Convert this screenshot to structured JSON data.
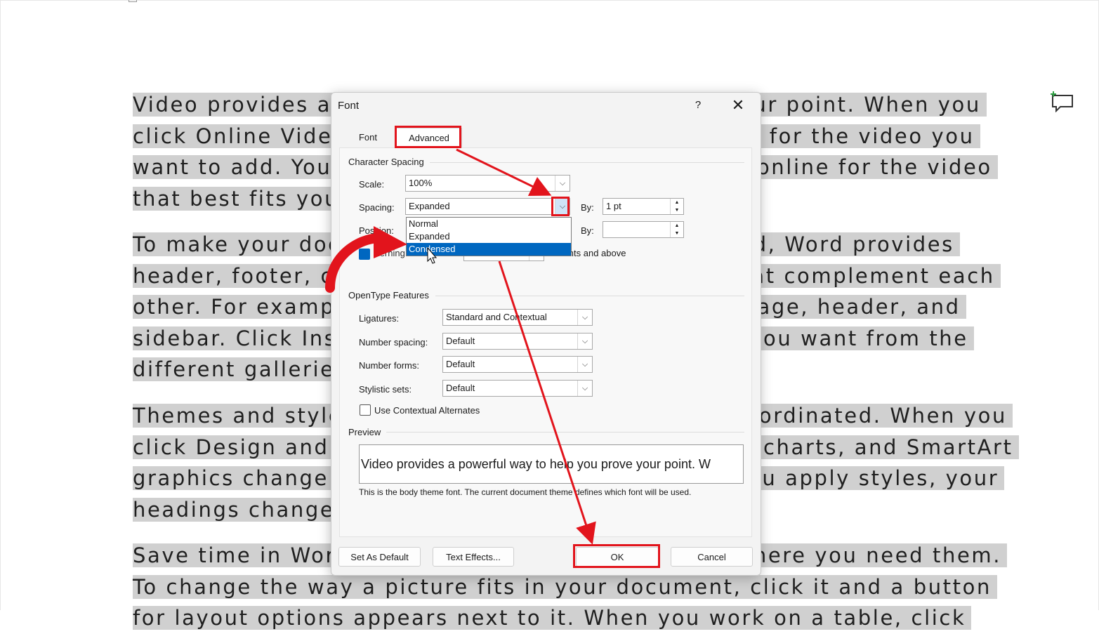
{
  "document": {
    "paragraphs": [
      {
        "lines": [
          "Video provides a powerful way to help you prove your point. When you",
          "click Online Video, you can paste in the embed code for the video you",
          "want to add. You can also type a keyword to search online for the video",
          "that best fits your document."
        ]
      },
      {
        "lines": [
          "To make your document look professionally produced, Word provides",
          "header, footer, cover page, and text box designs that complement each",
          "other. For example, you can add a matching cover page, header, and",
          "sidebar. Click Insert and then choose the elements you want from the",
          "different galleries."
        ]
      },
      {
        "lines": [
          "Themes and styles also help keep your document coordinated. When you",
          "click Design and choose a new Theme, the pictures, charts, and SmartArt",
          "graphics change to match your new theme. When you apply styles, your",
          "headings change to match the new theme."
        ]
      },
      {
        "lines": [
          "Save time in Word with new buttons that show up where you need them.",
          "To change the way a picture fits in your document, click it and a button",
          "for layout options appears next to it. When you work on a table, click"
        ]
      }
    ]
  },
  "dialog": {
    "title": "Font",
    "help": "?",
    "close": "✕",
    "tabs": [
      "Font",
      "Advanced"
    ],
    "character_spacing": {
      "heading": "Character Spacing",
      "scale_label": "Scale:",
      "scale_value": "100%",
      "spacing_label": "Spacing:",
      "spacing_value": "Expanded",
      "spacing_by_label": "By:",
      "spacing_by_value": "1 pt",
      "position_label": "Position:",
      "position_by_label": "By:",
      "position_by_value": "",
      "spacing_options": [
        "Normal",
        "Expanded",
        "Condensed"
      ],
      "kerning_label": "Kerning for fonts:",
      "kerning_suffix": "Points and above"
    },
    "opentype": {
      "heading": "OpenType Features",
      "ligatures_label": "Ligatures:",
      "ligatures_value": "Standard and Contextual",
      "number_spacing_label": "Number spacing:",
      "number_spacing_value": "Default",
      "number_forms_label": "Number forms:",
      "number_forms_value": "Default",
      "stylistic_sets_label": "Stylistic sets:",
      "stylistic_sets_value": "Default",
      "contextual_alternates_label": "Use Contextual Alternates"
    },
    "preview": {
      "heading": "Preview",
      "sample": "Video provides a powerful way to help you prove your point. W",
      "description": "This is the body theme font. The current document theme defines which font will be used."
    },
    "buttons": {
      "set_default": "Set As Default",
      "text_effects": "Text Effects...",
      "ok": "OK",
      "cancel": "Cancel"
    }
  },
  "annotation_color": "#e2141c",
  "selection_color": "#0067c0"
}
